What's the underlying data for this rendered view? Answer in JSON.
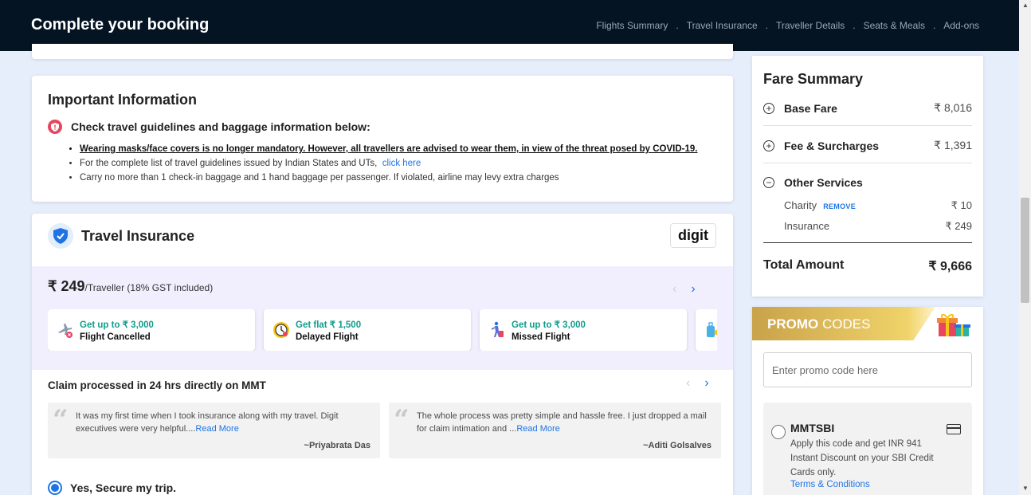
{
  "header": {
    "title": "Complete your booking",
    "steps": [
      "Flights Summary",
      "Travel Insurance",
      "Traveller Details",
      "Seats & Meals",
      "Add-ons"
    ]
  },
  "important_info": {
    "title": "Important Information",
    "guideline_heading": "Check travel guidelines and baggage information below:",
    "bullets": {
      "masks": "Wearing masks/face covers is no longer mandatory. However, all travellers are advised to wear them, in view of the threat posed by COVID-19.",
      "guidelines_text": "For the complete list of travel guidelines issued by Indian States and UTs,",
      "guidelines_link": "click here",
      "baggage": "Carry no more than 1 check-in baggage and 1 hand baggage per passenger. If violated, airline may levy extra charges"
    }
  },
  "insurance": {
    "title": "Travel Insurance",
    "provider_logo": "digit",
    "price": "₹ 249",
    "price_note": "/Traveller (18% GST included)",
    "benefits": [
      {
        "offer": "Get up to ₹ 3,000",
        "label": "Flight Cancelled",
        "icon": "flight-cancelled-icon"
      },
      {
        "offer": "Get flat ₹ 1,500",
        "label": "Delayed Flight",
        "icon": "delayed-flight-icon"
      },
      {
        "offer": "Get up to ₹ 3,000",
        "label": "Missed Flight",
        "icon": "missed-flight-icon"
      },
      {
        "offer": "",
        "label": "",
        "icon": "luggage-icon"
      }
    ],
    "claim_title": "Claim processed in 24 hrs directly on MMT",
    "reviews": [
      {
        "text": "It was my first time when I took insurance along with my travel. Digit executives were very helpful....",
        "more": "Read More",
        "author": "~Priyabrata Das"
      },
      {
        "text": "The whole process was pretty simple and hassle free. I just dropped a mail for claim intimation and ...",
        "more": "Read More",
        "author": "~Aditi Golsalves"
      }
    ],
    "secure_option": "Yes, Secure my trip."
  },
  "fare_summary": {
    "title": "Fare Summary",
    "base_fare": {
      "label": "Base Fare",
      "value": "₹ 8,016"
    },
    "fees": {
      "label": "Fee & Surcharges",
      "value": "₹ 1,391"
    },
    "other": {
      "label": "Other Services"
    },
    "charity": {
      "label": "Charity",
      "remove": "REMOVE",
      "value": "₹ 10"
    },
    "insurance": {
      "label": "Insurance",
      "value": "₹ 249"
    },
    "total": {
      "label": "Total Amount",
      "value": "₹ 9,666"
    }
  },
  "promo": {
    "title_bold": "PROMO",
    "title_rest": " CODES",
    "placeholder": "Enter promo code here",
    "coupon": {
      "code": "MMTSBI",
      "description": "Apply this code and get INR 941 Instant Discount on your SBI Credit Cards only.",
      "terms": "Terms & Conditions"
    }
  },
  "colors": {
    "header_bg": "#051423",
    "accent": "#1f74e4",
    "benefit_green": "#0f9d8a",
    "page_bg": "#e7eefb"
  }
}
